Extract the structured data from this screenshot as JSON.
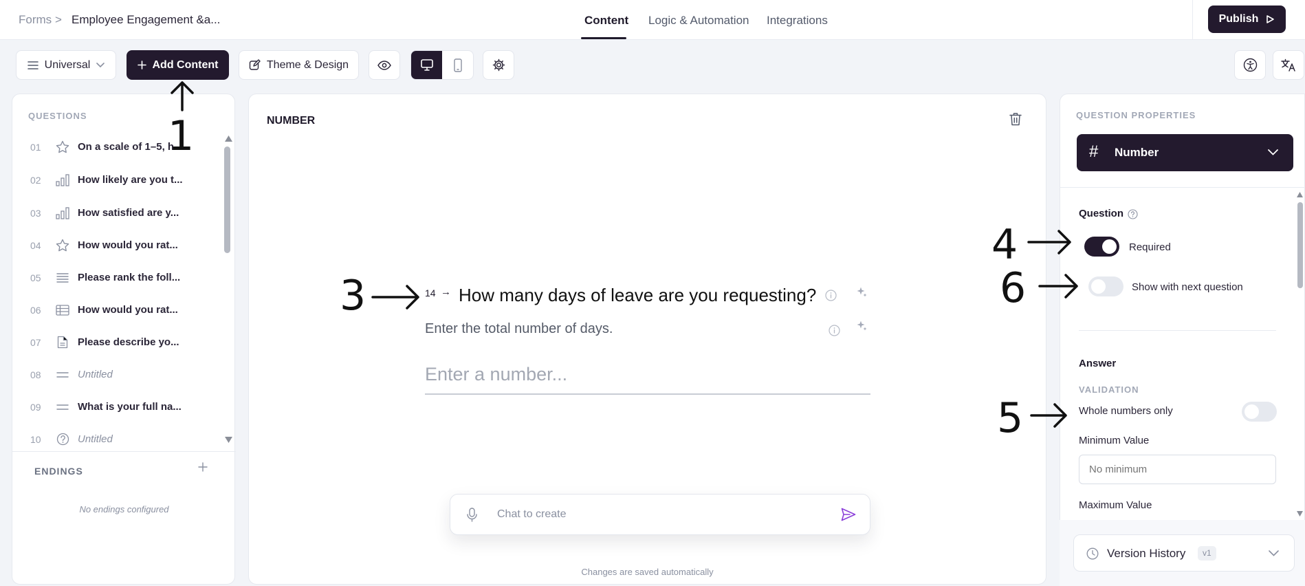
{
  "breadcrumb": {
    "root": "Forms",
    "separator": ">",
    "current": "Employee Engagement &a..."
  },
  "tabs": [
    {
      "label": "Content",
      "active": true
    },
    {
      "label": "Logic & Automation",
      "active": false
    },
    {
      "label": "Integrations",
      "active": false
    }
  ],
  "publish_label": "Publish",
  "toolbar": {
    "mode_select": "Universal",
    "add_content": "Add Content",
    "theme_design": "Theme & Design"
  },
  "questions_panel": {
    "header": "QUESTIONS",
    "items": [
      {
        "num": "01",
        "icon": "star-icon",
        "text": "On a scale of 1–5, h..."
      },
      {
        "num": "02",
        "icon": "bar-chart-icon",
        "text": "How likely are you t..."
      },
      {
        "num": "03",
        "icon": "bar-chart-icon",
        "text": "How satisfied are y..."
      },
      {
        "num": "04",
        "icon": "star-icon",
        "text": "How would you rat..."
      },
      {
        "num": "05",
        "icon": "ranking-icon",
        "text": "Please rank the foll..."
      },
      {
        "num": "06",
        "icon": "matrix-icon",
        "text": "How would you rat..."
      },
      {
        "num": "07",
        "icon": "document-icon",
        "text": "Please describe yo..."
      },
      {
        "num": "08",
        "icon": "short-text-icon",
        "text": "Untitled"
      },
      {
        "num": "09",
        "icon": "short-text-icon",
        "text": "What is your full na..."
      },
      {
        "num": "10",
        "icon": "help-circle-icon",
        "text": "Untitled"
      }
    ],
    "endings_header": "ENDINGS",
    "no_endings": "No endings configured"
  },
  "editor": {
    "type_label": "NUMBER",
    "question_number": "14",
    "question_arrow": "→",
    "question_text": "How many days of leave are you requesting?",
    "description": "Enter the total number of days.",
    "answer_placeholder": "Enter a number...",
    "chat_placeholder": "Chat to create",
    "autosave_note": "Changes are saved automatically"
  },
  "properties": {
    "header": "QUESTION PROPERTIES",
    "type": "Number",
    "type_symbol": "#",
    "question_section": "Question",
    "required_label": "Required",
    "required_on": true,
    "show_next_label": "Show with next question",
    "show_next_on": false,
    "answer_section": "Answer",
    "validation_label": "VALIDATION",
    "whole_numbers_label": "Whole numbers only",
    "whole_numbers_on": false,
    "min_label": "Minimum Value",
    "min_placeholder": "No minimum",
    "max_label": "Maximum Value",
    "version_history": "Version History",
    "version_badge": "v1"
  },
  "annotations": [
    "1",
    "3",
    "4",
    "6",
    "5"
  ]
}
